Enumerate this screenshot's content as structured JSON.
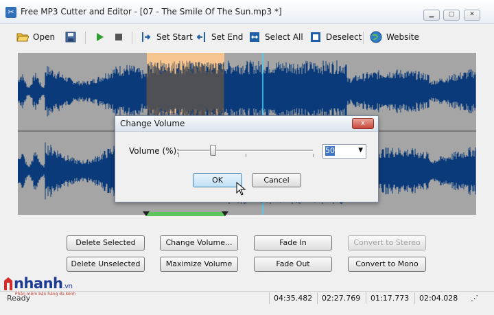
{
  "window": {
    "title": "Free MP3 Cutter and Editor - [07 - The Smile Of The Sun.mp3 *]",
    "controls": [
      "minimize-icon",
      "maximize-icon",
      "close-icon"
    ]
  },
  "toolbar": {
    "open_label": "Open",
    "save_icon": "save-icon",
    "play_icon": "play-icon",
    "stop_icon": "stop-icon",
    "set_start_label": "Set Start",
    "set_end_label": "Set End",
    "select_all_label": "Select All",
    "deselect_label": "Deselect",
    "website_label": "Website"
  },
  "waveform": {
    "background": "#a5a5a5",
    "wave_color": "#0b3a7a",
    "selection_color": "#f7c58f",
    "cursor_color": "#3fd6ff"
  },
  "dialog": {
    "title": "Change Volume",
    "close_glyph": "x",
    "volume_label": "Volume (%):",
    "volume_value": "50",
    "ok_label": "OK",
    "cancel_label": "Cancel"
  },
  "actions": {
    "delete_selected": "Delete Selected",
    "change_volume": "Change Volume...",
    "fade_in": "Fade In",
    "convert_to_stereo": "Convert to Stereo",
    "delete_unselected": "Delete Unselected",
    "maximize_volume": "Maximize Volume",
    "fade_out": "Fade Out",
    "convert_to_mono": "Convert to Mono"
  },
  "status": {
    "ready": "Ready",
    "total_length": "04:35.482",
    "selection_start": "02:27.769",
    "selection_length": "01:17.773",
    "cursor_position": "02:04.028"
  },
  "watermark": {
    "brand": "nhanh",
    "suffix": ".vn",
    "tagline": "Phần mềm bán hàng đa kênh"
  }
}
